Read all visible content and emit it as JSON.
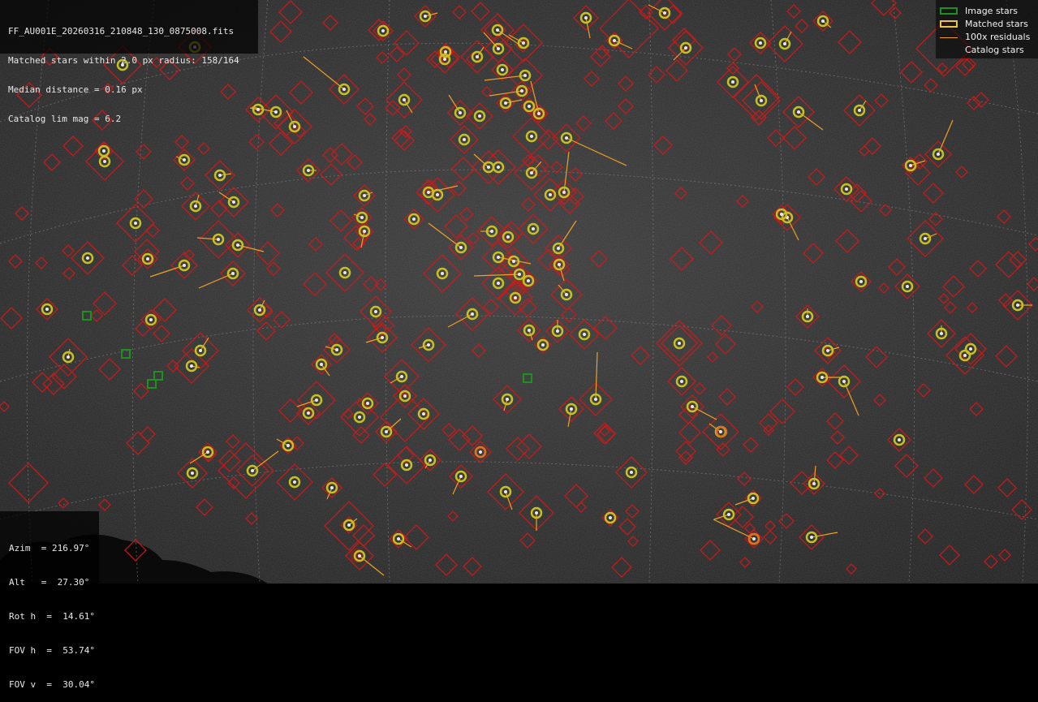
{
  "header": {
    "filename": "FF_AU001E_20260316_210848_130_0875008.fits",
    "matched_line": "Matched stars within 2.0 px radius: 158/164",
    "median_line": "Median distance = 0.16 px",
    "catalog_line": "Catalog lim mag = 6.2"
  },
  "legend": {
    "items": [
      {
        "label": "Image stars",
        "color": "#1f8f1f",
        "symbol": "image-star-square-icon"
      },
      {
        "label": "Matched stars",
        "color": "#e8c547",
        "symbol": "matched-star-square-icon"
      },
      {
        "label": "100x residuals",
        "color": "#f0a020",
        "symbol": "residual-line-icon"
      },
      {
        "label": "Catalog stars",
        "color": "#d01818",
        "symbol": "catalog-star-diamond-icon"
      }
    ]
  },
  "pointing": {
    "azim": "Azim  = 216.97°",
    "alt": "Alt   =  27.30°",
    "rot_h": "Rot h  =  14.61°",
    "fov_h": "FOV h  =  53.74°",
    "fov_v": "FOV v  =  30.04°"
  },
  "colors": {
    "background": "#000000",
    "catalog": "#d01818",
    "matched_ring": "#c8c020",
    "matched_ring_fill": "#e8a030",
    "image_star": "#1f8f1f",
    "residual": "#f0a020",
    "grid": "#8a8a8a"
  }
}
